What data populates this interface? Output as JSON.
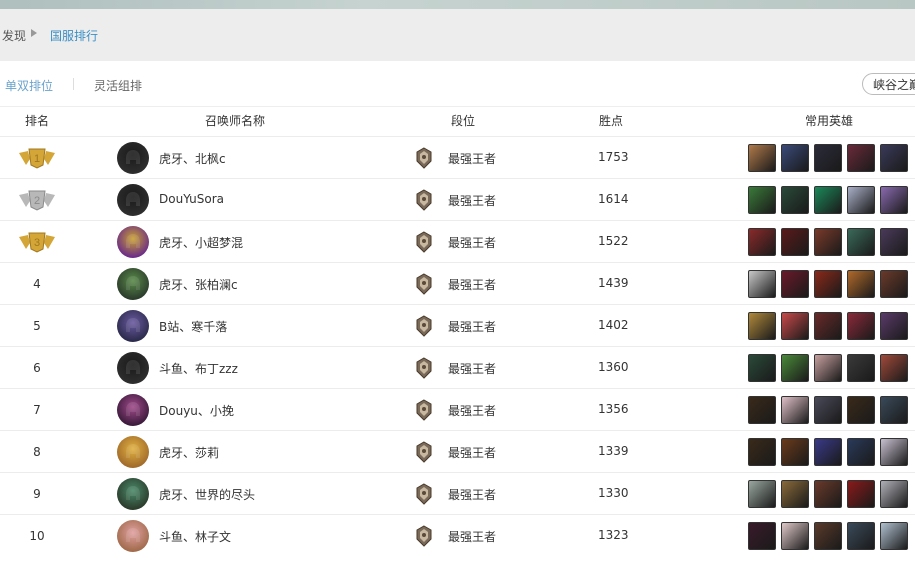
{
  "breadcrumb": {
    "home": "发现",
    "current": "国服排行"
  },
  "tabs": [
    {
      "label": "单双排位",
      "active": true
    },
    {
      "label": "灵活组排",
      "active": false
    }
  ],
  "map_select": {
    "value": "峡谷之巅"
  },
  "headers": {
    "rank": "排名",
    "name": "召唤师名称",
    "tier": "段位",
    "points": "胜点",
    "heroes": "常用英雄"
  },
  "colors": {
    "accent": "#3b8fc4",
    "gold": "#d4a537",
    "silver": "#b8b8b8"
  },
  "rows": [
    {
      "rank": "1",
      "medal": "gold",
      "name": "虎牙、北枫c",
      "tier": "最强王者",
      "points": "1753",
      "avatar": [
        "#1a1a1a",
        "#2e2e2e"
      ],
      "heroes": [
        "#b07a4a",
        "#3a4a7a",
        "#2b2b3a",
        "#6a2a3a",
        "#3a3a5a"
      ]
    },
    {
      "rank": "2",
      "medal": "silver",
      "name": "DouYuSora",
      "tier": "最强王者",
      "points": "1614",
      "avatar": [
        "#1a1a1a",
        "#2e2e2e"
      ],
      "heroes": [
        "#3a7a3a",
        "#2a4a3a",
        "#1a8a5a",
        "#aab0c8",
        "#8a6ab0"
      ]
    },
    {
      "rank": "3",
      "medal": "gold",
      "name": "虎牙、小超梦混",
      "tier": "最强王者",
      "points": "1522",
      "avatar": [
        "#c8a030",
        "#6a2a8a"
      ],
      "heroes": [
        "#8a2a2a",
        "#5a1a1a",
        "#7a3a2a",
        "#3a6a5a",
        "#4a3a5a"
      ]
    },
    {
      "rank": "4",
      "medal": "",
      "name": "虎牙、张柏澜c",
      "tier": "最强王者",
      "points": "1439",
      "avatar": [
        "#5a8a4a",
        "#2a3a2a"
      ],
      "heroes": [
        "#c8c8c8",
        "#6a1a2a",
        "#8a2a1a",
        "#b06a2a",
        "#6a3a2a"
      ]
    },
    {
      "rank": "5",
      "medal": "",
      "name": "B站、寒千落",
      "tier": "最强王者",
      "points": "1402",
      "avatar": [
        "#6a5aa0",
        "#2a2a4a"
      ],
      "heroes": [
        "#b08a3a",
        "#c84a4a",
        "#6a2a2a",
        "#8a2a3a",
        "#5a3a6a"
      ]
    },
    {
      "rank": "6",
      "medal": "",
      "name": "斗鱼、布丁zzz",
      "tier": "最强王者",
      "points": "1360",
      "avatar": [
        "#1a1a1a",
        "#2e2e2e"
      ],
      "heroes": [
        "#2a4a3a",
        "#4a8a3a",
        "#c8a0a0",
        "#3a3a3a",
        "#a04a3a"
      ]
    },
    {
      "rank": "7",
      "medal": "",
      "name": "Douyu、小挽",
      "tier": "最强王者",
      "points": "1356",
      "avatar": [
        "#a04a8a",
        "#3a1a3a"
      ],
      "heroes": [
        "#3a2a1a",
        "#e0c0c8",
        "#4a4a5a",
        "#3a2a1a",
        "#3a4a5a"
      ]
    },
    {
      "rank": "8",
      "medal": "",
      "name": "虎牙、莎莉",
      "tier": "最强王者",
      "points": "1339",
      "avatar": [
        "#e0b040",
        "#a06a2a"
      ],
      "heroes": [
        "#3a2a1a",
        "#6a3a1a",
        "#3a3a8a",
        "#2a3a5a",
        "#c8c0d0"
      ]
    },
    {
      "rank": "9",
      "medal": "",
      "name": "虎牙、世界的尽头",
      "tier": "最强王者",
      "points": "1330",
      "avatar": [
        "#4a8a6a",
        "#2a3a2a"
      ],
      "heroes": [
        "#9aa8a0",
        "#8a6a3a",
        "#6a3a2a",
        "#8a1a1a",
        "#b0b0b8"
      ]
    },
    {
      "rank": "10",
      "medal": "",
      "name": "斗鱼、林子文",
      "tier": "最强王者",
      "points": "1323",
      "avatar": [
        "#e0a0a0",
        "#a06a4a"
      ],
      "heroes": [
        "#3a1a2a",
        "#e0c8c8",
        "#5a3a2a",
        "#3a4a5a",
        "#b0c0d0"
      ]
    }
  ]
}
